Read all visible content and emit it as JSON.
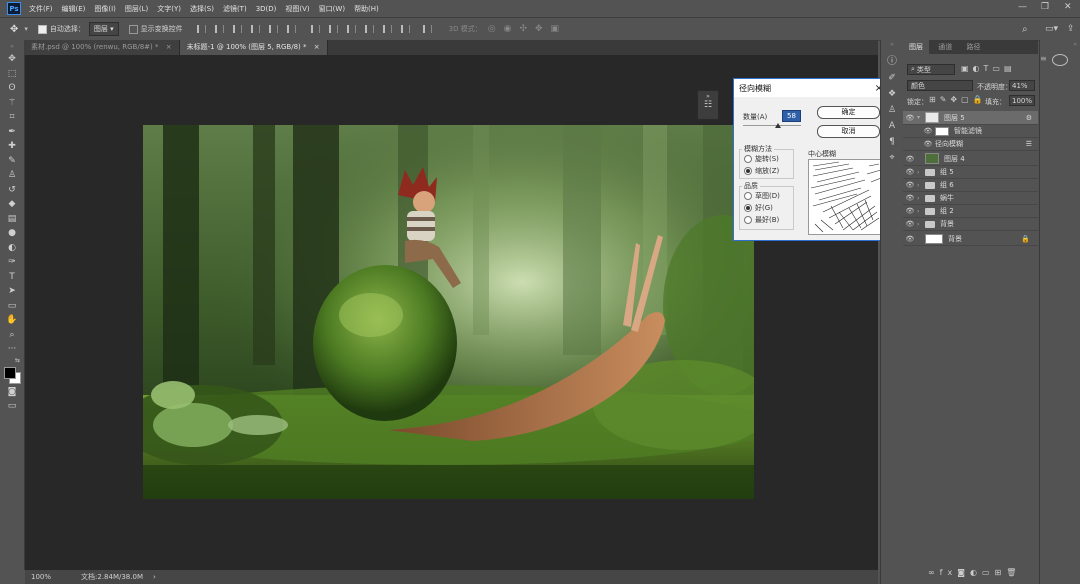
{
  "menu": {
    "logo": "Ps",
    "items": [
      "文件(F)",
      "编辑(E)",
      "图像(I)",
      "图层(L)",
      "文字(Y)",
      "选择(S)",
      "滤镜(T)",
      "3D(D)",
      "视图(V)",
      "窗口(W)",
      "帮助(H)"
    ]
  },
  "options": {
    "auto_select_label": "自动选择：",
    "auto_select_value": "图层",
    "show_transform_label": "显示变换控件",
    "mode_3d_label": "3D 模式："
  },
  "tabs": [
    {
      "label": "素材.psd @ 100% (renwu, RGB/8#) *",
      "close": "×"
    },
    {
      "label": "未标题-1 @ 100% (图层 5, RGB/8) *",
      "close": "×"
    }
  ],
  "status": {
    "zoom": "100%",
    "doc": "文档:2.84M/38.0M",
    "arrow": "›"
  },
  "dialog": {
    "title": "径向模糊",
    "close": "×",
    "amount_label": "数量(A)",
    "amount_value": "58",
    "ok": "确定",
    "cancel": "取消",
    "method_label": "模糊方法",
    "methods": [
      "旋转(S)",
      "缩放(Z)"
    ],
    "method_selected": 1,
    "quality_label": "品质",
    "qualities": [
      "草图(D)",
      "好(G)",
      "最好(B)"
    ],
    "quality_selected": 1,
    "center_label": "中心模糊"
  },
  "panel": {
    "tabs": [
      "图层",
      "通道",
      "路径"
    ],
    "filter_kind": "类型",
    "blend_mode": "颜色",
    "opacity_label": "不透明度：",
    "opacity_value": "41%",
    "lock_label": "锁定：",
    "fill_label": "填充：",
    "fill_value": "100%",
    "layers": [
      {
        "name": "图层 5",
        "kind": "smart",
        "selected": true
      },
      {
        "name": "智能滤镜",
        "kind": "sub"
      },
      {
        "name": "径向模糊",
        "kind": "filter"
      },
      {
        "name": "图层 4",
        "kind": "image"
      },
      {
        "name": "组 5",
        "kind": "group"
      },
      {
        "name": "组 6",
        "kind": "group"
      },
      {
        "name": "蜗牛",
        "kind": "group"
      },
      {
        "name": "组 2",
        "kind": "group"
      },
      {
        "name": "背景",
        "kind": "group"
      },
      {
        "name": "背景",
        "kind": "background"
      }
    ]
  },
  "colors": {
    "accent": "#2e6fd0",
    "ui_bg": "#535353",
    "canvas_bg": "#282828",
    "selected_layer": "#6b6b6b"
  },
  "icons": {
    "tools": [
      "move-icon",
      "marquee-icon",
      "lasso-icon",
      "magic-wand-icon",
      "crop-icon",
      "eyedropper-icon",
      "healing-brush-icon",
      "brush-icon",
      "clone-stamp-icon",
      "history-brush-icon",
      "eraser-icon",
      "gradient-icon",
      "blur-icon",
      "dodge-icon",
      "pen-icon",
      "type-icon",
      "path-select-icon",
      "shape-icon",
      "hand-icon",
      "zoom-icon",
      "more-tools-icon",
      "swap-colors-icon",
      "color-swatch-icon",
      "quick-mask-icon",
      "screen-mode-icon"
    ]
  }
}
